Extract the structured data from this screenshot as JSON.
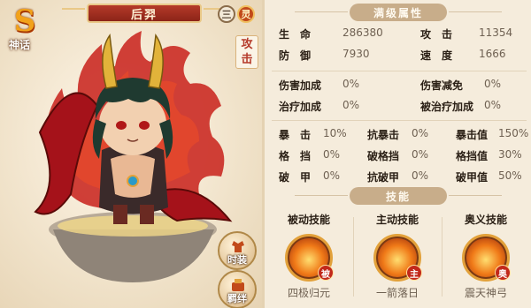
{
  "hero": {
    "rank": "S",
    "rank_label": "神话",
    "name": "后羿",
    "menu_icon": "三",
    "element_icon": "灵",
    "role": "攻击"
  },
  "side_buttons": {
    "fashion": "时装",
    "bond": "羁绊"
  },
  "attributes": {
    "title": "满级属性",
    "hp_label": "生　命",
    "hp": "286380",
    "atk_label": "攻　击",
    "atk": "11354",
    "def_label": "防　御",
    "def": "7930",
    "spd_label": "速　度",
    "spd": "1666",
    "dmg_bonus_label": "伤害加成",
    "dmg_bonus": "0%",
    "dmg_reduce_label": "伤害减免",
    "dmg_reduce": "0%",
    "heal_bonus_label": "治疗加成",
    "heal_bonus": "0%",
    "healed_bonus_label": "被治疗加成",
    "healed_bonus": "0%",
    "crit_label": "暴　击",
    "crit": "10%",
    "crit_res_label": "抗暴击",
    "crit_res": "0%",
    "crit_dmg_label": "暴击值",
    "crit_dmg": "150%",
    "block_label": "格　挡",
    "block": "0%",
    "block_break_label": "破格挡",
    "block_break": "0%",
    "block_val_label": "格挡值",
    "block_val": "30%",
    "pen_label": "破　甲",
    "pen": "0%",
    "pen_res_label": "抗破甲",
    "pen_res": "0%",
    "pen_val_label": "破甲值",
    "pen_val": "50%"
  },
  "skills": {
    "title": "技能",
    "passive": {
      "type": "被动技能",
      "tag": "被",
      "name": "四极归元"
    },
    "active": {
      "type": "主动技能",
      "tag": "主",
      "name": "一箭落日"
    },
    "ultimate": {
      "type": "奥义技能",
      "tag": "奥",
      "name": "震天神弓"
    }
  },
  "colors": {
    "accent_red": "#b53a2a",
    "gold": "#e2a13a",
    "panel_bg": "#f5ecdc"
  }
}
